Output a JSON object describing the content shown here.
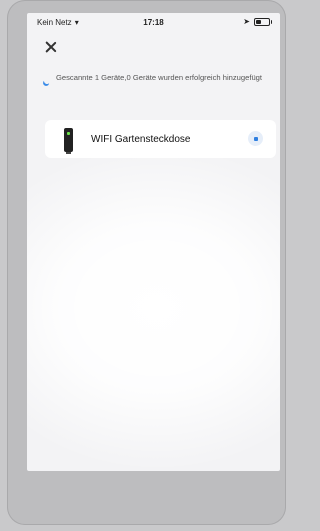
{
  "status_bar": {
    "carrier": "Kein Netz",
    "time": "17:18"
  },
  "scan": {
    "message": "Gescannte 1 Geräte,0 Geräte wurden erfolgreich hinzugefügt"
  },
  "devices": [
    {
      "name": "WIFI Gartensteckdose"
    }
  ],
  "colors": {
    "accent": "#2f7fe0",
    "background": "#f3f3f5"
  },
  "icons": {
    "close": "close-icon",
    "wifi": "wifi-icon",
    "location": "location-arrow-icon",
    "battery": "battery-icon",
    "scan": "moon-icon",
    "device": "garden-socket-icon",
    "add": "add-device-icon"
  }
}
